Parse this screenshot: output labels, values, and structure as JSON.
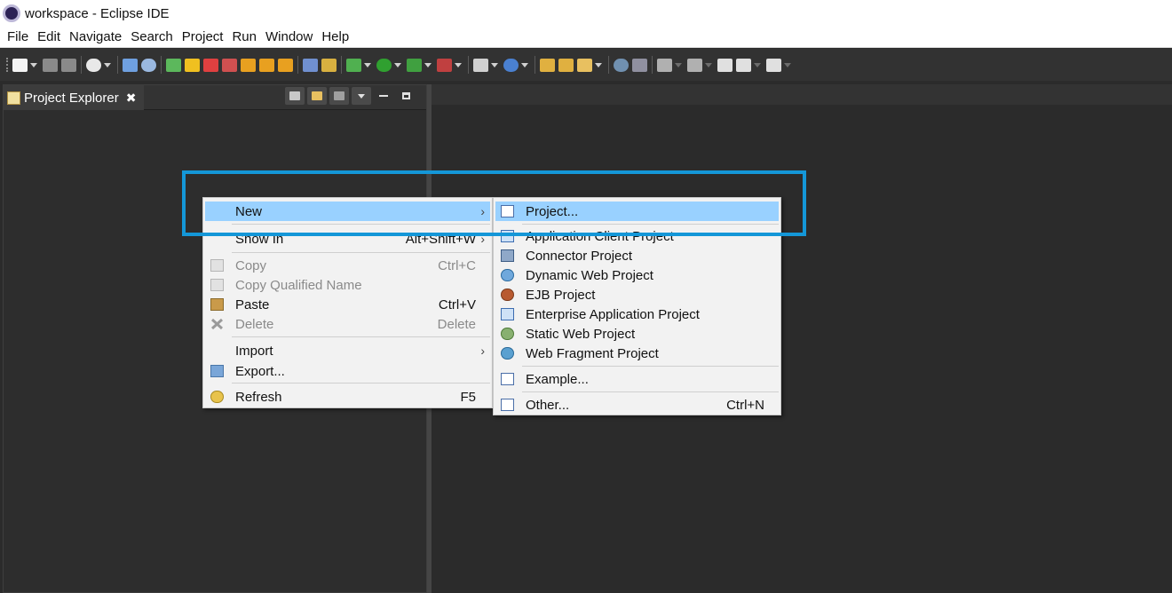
{
  "window": {
    "title": "workspace - Eclipse IDE"
  },
  "menubar": {
    "items": [
      "File",
      "Edit",
      "Navigate",
      "Search",
      "Project",
      "Run",
      "Window",
      "Help"
    ]
  },
  "view": {
    "tab_label": "Project Explorer",
    "close_glyph": "✖"
  },
  "context_menu": {
    "items": [
      {
        "label": "New",
        "accel": "",
        "submenu": "›",
        "disabled": false,
        "icon": "none"
      },
      {
        "label": "Show In",
        "accel": "Alt+Shift+W",
        "submenu": "›",
        "disabled": false,
        "icon": "none"
      },
      {
        "label": "Copy",
        "accel": "Ctrl+C",
        "submenu": "",
        "disabled": true,
        "icon": "copy-icon"
      },
      {
        "label": "Copy Qualified Name",
        "accel": "",
        "submenu": "",
        "disabled": true,
        "icon": "copy-qualified-name-icon"
      },
      {
        "label": "Paste",
        "accel": "Ctrl+V",
        "submenu": "",
        "disabled": false,
        "icon": "paste-icon"
      },
      {
        "label": "Delete",
        "accel": "Delete",
        "submenu": "",
        "disabled": true,
        "icon": "delete-icon"
      },
      {
        "label": "Import",
        "accel": "",
        "submenu": "›",
        "disabled": false,
        "icon": "none"
      },
      {
        "label": "Export...",
        "accel": "",
        "submenu": "",
        "disabled": false,
        "icon": "export-icon"
      },
      {
        "label": "Refresh",
        "accel": "F5",
        "submenu": "",
        "disabled": false,
        "icon": "refresh-icon"
      }
    ]
  },
  "new_submenu": {
    "items": [
      {
        "label": "Project...",
        "accel": "",
        "icon": "new-project-icon",
        "highlighted": true
      },
      {
        "label": "Application Client Project",
        "accel": "",
        "icon": "application-client-project-icon"
      },
      {
        "label": "Connector Project",
        "accel": "",
        "icon": "connector-project-icon"
      },
      {
        "label": "Dynamic Web Project",
        "accel": "",
        "icon": "dynamic-web-project-icon"
      },
      {
        "label": "EJB Project",
        "accel": "",
        "icon": "ejb-project-icon"
      },
      {
        "label": "Enterprise Application Project",
        "accel": "",
        "icon": "enterprise-application-project-icon"
      },
      {
        "label": "Static Web Project",
        "accel": "",
        "icon": "static-web-project-icon"
      },
      {
        "label": "Web Fragment Project",
        "accel": "",
        "icon": "web-fragment-project-icon"
      },
      {
        "label": "Example...",
        "accel": "",
        "icon": "example-icon"
      },
      {
        "label": "Other...",
        "accel": "Ctrl+N",
        "icon": "other-wizard-icon"
      }
    ]
  },
  "colors": {
    "menu_highlight": "#99d1ff",
    "annotation_box": "#1497d8",
    "dark_background": "#2b2b2b"
  }
}
